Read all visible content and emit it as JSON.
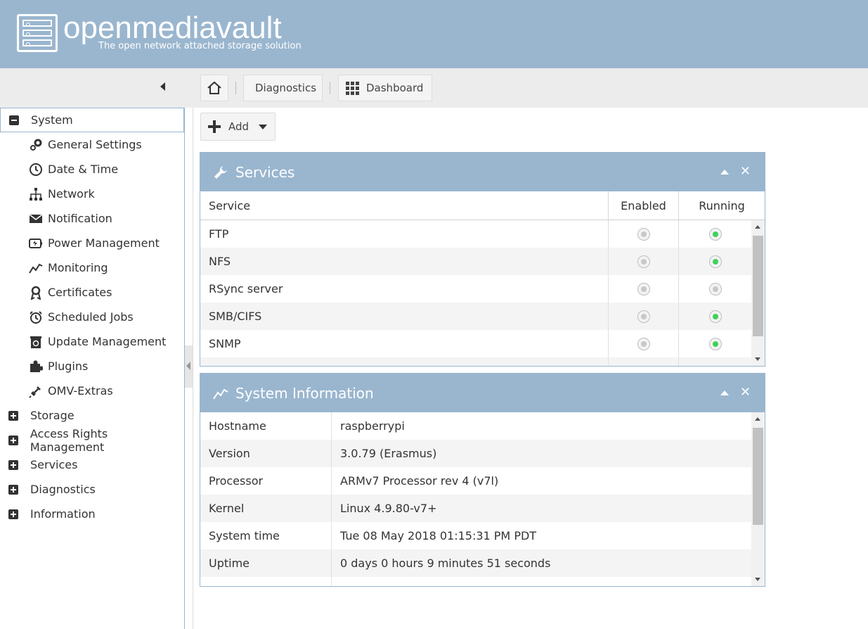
{
  "app": {
    "title": "openmediavault",
    "subtitle": "The open network attached storage solution"
  },
  "breadcrumb": {
    "home_icon": "home-icon",
    "items": [
      "Diagnostics",
      "Dashboard"
    ]
  },
  "toolbar": {
    "add_label": "Add"
  },
  "sidebar": {
    "root_selected": "System",
    "system_children": [
      {
        "label": "General Settings",
        "icon": "gears-icon"
      },
      {
        "label": "Date & Time",
        "icon": "clock-icon"
      },
      {
        "label": "Network",
        "icon": "network-icon"
      },
      {
        "label": "Notification",
        "icon": "envelope-icon"
      },
      {
        "label": "Power Management",
        "icon": "power-icon"
      },
      {
        "label": "Monitoring",
        "icon": "monitoring-chart-icon"
      },
      {
        "label": "Certificates",
        "icon": "certificate-icon"
      },
      {
        "label": "Scheduled Jobs",
        "icon": "alarm-clock-icon"
      },
      {
        "label": "Update Management",
        "icon": "update-icon"
      },
      {
        "label": "Plugins",
        "icon": "puzzle-icon"
      },
      {
        "label": "OMV-Extras",
        "icon": "plug-icon"
      }
    ],
    "roots": [
      "Storage",
      "Access Rights Management",
      "Services",
      "Diagnostics",
      "Information"
    ]
  },
  "services_panel": {
    "title": "Services",
    "columns": [
      "Service",
      "Enabled",
      "Running"
    ],
    "rows": [
      {
        "name": "FTP",
        "enabled": false,
        "running": true
      },
      {
        "name": "NFS",
        "enabled": false,
        "running": true
      },
      {
        "name": "RSync server",
        "enabled": false,
        "running": false
      },
      {
        "name": "SMB/CIFS",
        "enabled": false,
        "running": true
      },
      {
        "name": "SNMP",
        "enabled": false,
        "running": true
      }
    ]
  },
  "sysinfo_panel": {
    "title": "System Information",
    "rows": [
      {
        "key": "Hostname",
        "value": "raspberrypi"
      },
      {
        "key": "Version",
        "value": "3.0.79 (Erasmus)"
      },
      {
        "key": "Processor",
        "value": "ARMv7 Processor rev 4 (v7l)"
      },
      {
        "key": "Kernel",
        "value": "Linux 4.9.80-v7+"
      },
      {
        "key": "System time",
        "value": "Tue 08 May 2018 01:15:31 PM PDT"
      },
      {
        "key": "Uptime",
        "value": "0 days 0 hours 9 minutes 51 seconds"
      }
    ]
  },
  "colors": {
    "header_bg": "#9ab6cf",
    "running_green": "#3fd15a"
  }
}
